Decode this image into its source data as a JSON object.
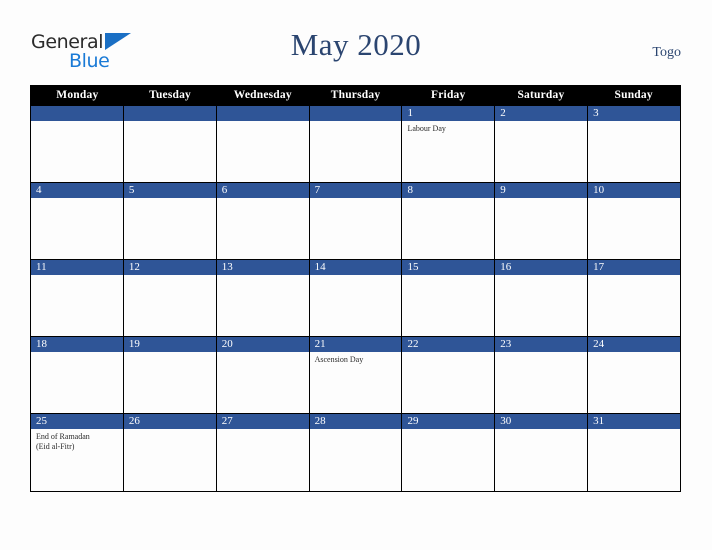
{
  "brand": {
    "name_part1": "General",
    "name_part2": "Blue",
    "triangle_icon": "triangle-icon"
  },
  "header": {
    "title": "May 2020",
    "country": "Togo"
  },
  "calendar": {
    "day_headers": [
      "Monday",
      "Tuesday",
      "Wednesday",
      "Thursday",
      "Friday",
      "Saturday",
      "Sunday"
    ],
    "colors": {
      "header_bg": "#000000",
      "date_bar_bg": "#2f5597",
      "date_text": "#ffffff",
      "title_text": "#2b4570",
      "page_bg": "#fdfdfd",
      "grid_line": "#000000",
      "event_text": "#2b2b2b"
    },
    "weeks": [
      [
        {
          "date": "",
          "events": ""
        },
        {
          "date": "",
          "events": ""
        },
        {
          "date": "",
          "events": ""
        },
        {
          "date": "",
          "events": ""
        },
        {
          "date": "1",
          "events": "Labour Day"
        },
        {
          "date": "2",
          "events": ""
        },
        {
          "date": "3",
          "events": ""
        }
      ],
      [
        {
          "date": "4",
          "events": ""
        },
        {
          "date": "5",
          "events": ""
        },
        {
          "date": "6",
          "events": ""
        },
        {
          "date": "7",
          "events": ""
        },
        {
          "date": "8",
          "events": ""
        },
        {
          "date": "9",
          "events": ""
        },
        {
          "date": "10",
          "events": ""
        }
      ],
      [
        {
          "date": "11",
          "events": ""
        },
        {
          "date": "12",
          "events": ""
        },
        {
          "date": "13",
          "events": ""
        },
        {
          "date": "14",
          "events": ""
        },
        {
          "date": "15",
          "events": ""
        },
        {
          "date": "16",
          "events": ""
        },
        {
          "date": "17",
          "events": ""
        }
      ],
      [
        {
          "date": "18",
          "events": ""
        },
        {
          "date": "19",
          "events": ""
        },
        {
          "date": "20",
          "events": ""
        },
        {
          "date": "21",
          "events": "Ascension Day"
        },
        {
          "date": "22",
          "events": ""
        },
        {
          "date": "23",
          "events": ""
        },
        {
          "date": "24",
          "events": ""
        }
      ],
      [
        {
          "date": "25",
          "events": "End of Ramadan\n(Eid al-Fitr)"
        },
        {
          "date": "26",
          "events": ""
        },
        {
          "date": "27",
          "events": ""
        },
        {
          "date": "28",
          "events": ""
        },
        {
          "date": "29",
          "events": ""
        },
        {
          "date": "30",
          "events": ""
        },
        {
          "date": "31",
          "events": ""
        }
      ]
    ]
  }
}
